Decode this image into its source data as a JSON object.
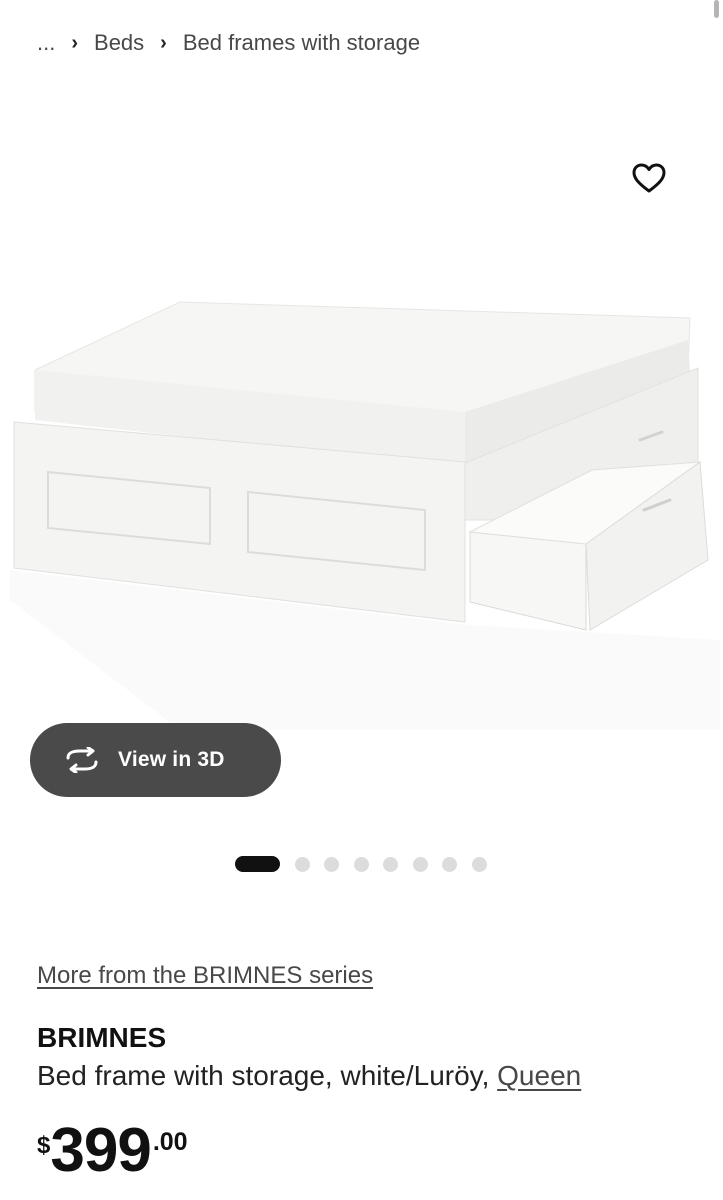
{
  "breadcrumb": {
    "ellipsis": "...",
    "items": [
      {
        "label": "Beds"
      },
      {
        "label": "Bed frames with storage"
      }
    ]
  },
  "favorite": {
    "icon": "heart-outline-icon"
  },
  "gallery": {
    "view3d_label": "View in 3D",
    "view3d_icon": "rotate-3d-icon",
    "slide_count": 8,
    "active_slide": 1
  },
  "product": {
    "series_link": "More from the BRIMNES series",
    "name": "BRIMNES",
    "description": "Bed frame with storage, white/Luröy, ",
    "size_link": "Queen",
    "price": {
      "currency": "$",
      "integer": "399",
      "decimal": ".00"
    }
  },
  "colors": {
    "text_primary": "#111111",
    "text_secondary": "#484848",
    "pill_bg": "#4a4a4a",
    "dot_inactive": "#dcdcdc"
  }
}
